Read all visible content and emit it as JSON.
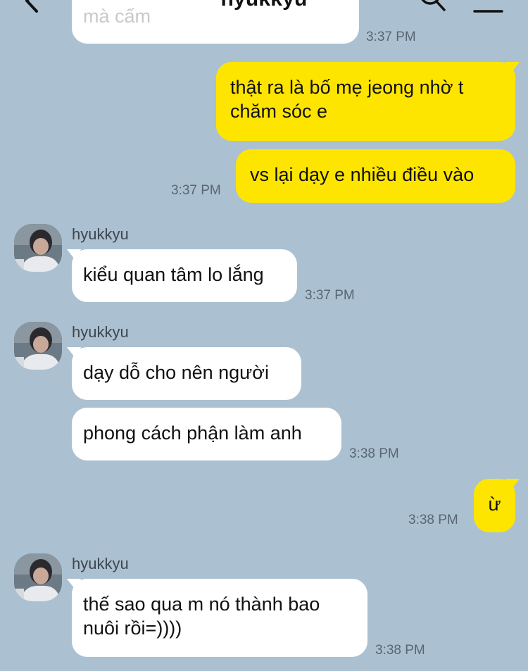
{
  "header": {
    "title": "hyukkyu",
    "back_icon": "chevron-left-icon",
    "search_icon": "search-icon",
    "menu_icon": "hamburger-menu-icon"
  },
  "colors": {
    "background": "#abc1d1",
    "outgoing_bubble": "#fee500",
    "incoming_bubble": "#ffffff"
  },
  "messages": [
    {
      "direction": "in",
      "lines": [
        "mà cấm"
      ],
      "time": "3:37 PM",
      "partial": true
    },
    {
      "direction": "out",
      "lines": [
        "thật ra là bố mẹ jeong nhờ t",
        "chăm sóc e"
      ],
      "time": ""
    },
    {
      "direction": "out",
      "lines": [
        "vs lại dạy e nhiều điều vào"
      ],
      "time": "3:37 PM"
    },
    {
      "direction": "in",
      "sender": "hyukkyu",
      "lines": [
        "kiểu quan tâm lo lắng"
      ],
      "time": "3:37 PM"
    },
    {
      "direction": "in",
      "sender": "hyukkyu",
      "lines": [
        "dạy dỗ cho nên người"
      ],
      "time": ""
    },
    {
      "direction": "in",
      "lines": [
        "phong cách phận làm anh"
      ],
      "time": "3:38 PM"
    },
    {
      "direction": "out",
      "lines": [
        "ừ"
      ],
      "time": "3:38 PM"
    },
    {
      "direction": "in",
      "sender": "hyukkyu",
      "lines": [
        "thế sao qua m nó thành bao",
        "nuôi rồi=))))"
      ],
      "time": "3:38 PM"
    }
  ]
}
